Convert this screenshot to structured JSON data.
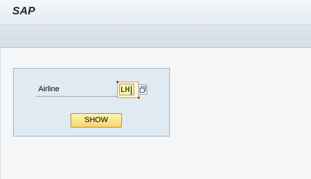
{
  "window": {
    "title": "SAP"
  },
  "form": {
    "airline_label": "Airline",
    "airline_value": "LH",
    "value_help_icon": "value-help-icon",
    "show_button_label": "SHOW"
  },
  "colors": {
    "titlebar": "#e5ebf1",
    "toolbar": "#d4dee8",
    "panel": "#e0eaf2",
    "input_focus": "#fff3a8",
    "button": "#f7d66f"
  }
}
